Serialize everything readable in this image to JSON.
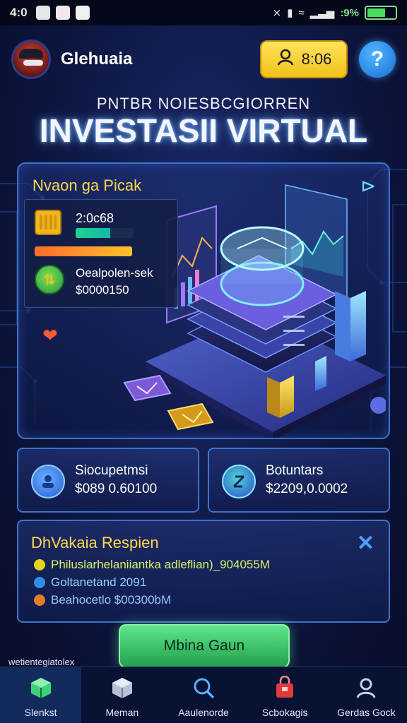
{
  "status_bar": {
    "time": "4:0",
    "battery_text": ":9%",
    "colors": {
      "battery": "#4cd964"
    }
  },
  "header": {
    "username": "Glehuaia",
    "coins": "8:06",
    "coin_icon": "user-icon",
    "help_icon": "help-icon"
  },
  "title": {
    "subtitle": "PNTBR NOIESBCGIORREN",
    "main": "INVESTASII VIRTUAL"
  },
  "hero": {
    "title": "Nvaon ga Picak",
    "stat": {
      "value1": "2:0c68",
      "green_progress": 0.6,
      "orange_progress": 1.0,
      "label2": "Oealpolen-sek",
      "value2": "$0000150"
    }
  },
  "cards": [
    {
      "label": "Siocupetmsi",
      "value": "$089 0.60100",
      "icon": "user-badge-icon"
    },
    {
      "label": "Botuntars",
      "value": "$2209,0.0002",
      "icon": "chart-badge-icon"
    }
  ],
  "reward": {
    "title": "DhVakaia Respien",
    "items": [
      {
        "text": "Philuslarhelaniiantka adleflian)_904055M",
        "color": "#e8d21a"
      },
      {
        "text": "Goltanetand 2091",
        "color": "#2f8fe8"
      },
      {
        "text": "Beahocetlo $00300bM",
        "color": "#e87a2a"
      }
    ]
  },
  "action": {
    "label": "Mbina Gaun",
    "footnote": "wetientegiatolex"
  },
  "nav": [
    {
      "label": "Slenkst",
      "icon": "cube-icon",
      "active": true
    },
    {
      "label": "Meman",
      "icon": "box-icon",
      "active": false
    },
    {
      "label": "Aaulenorde",
      "icon": "search-icon",
      "active": false
    },
    {
      "label": "Scbokagis",
      "icon": "bag-icon",
      "active": false
    },
    {
      "label": "Gerdas Gock",
      "icon": "profile-icon",
      "active": false
    }
  ]
}
